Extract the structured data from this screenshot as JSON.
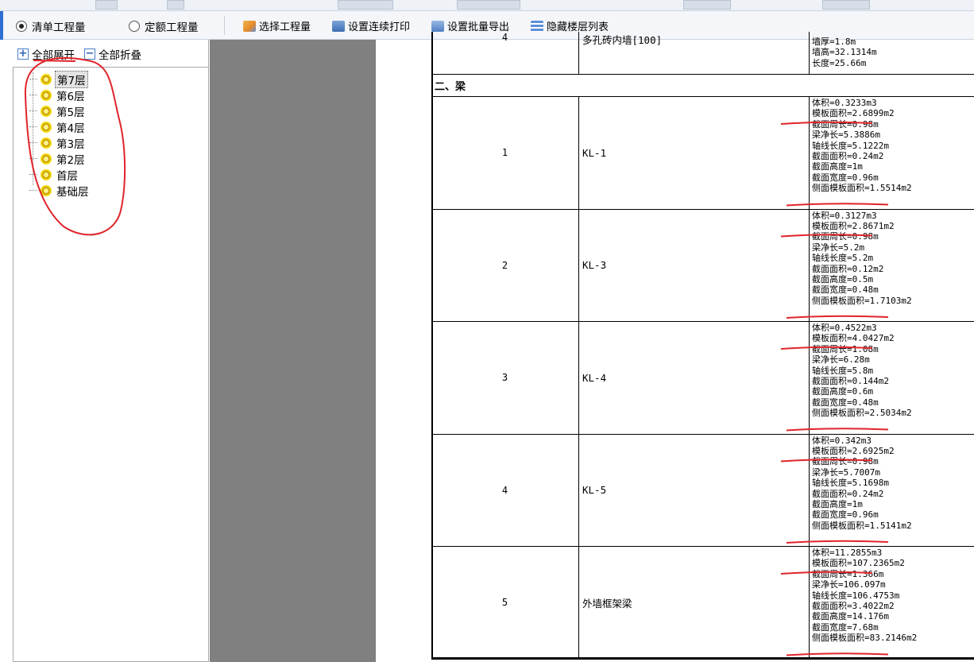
{
  "toolbar": {
    "radio_qingdan": "清单工程量",
    "radio_dinge": "定额工程量",
    "btn_select": "选择工程量",
    "btn_print": "设置连续打印",
    "btn_export": "设置批量导出",
    "btn_hide": "隐藏楼层列表"
  },
  "left_panel": {
    "expand_all": "全部展开",
    "collapse_all": "全部折叠",
    "floors": [
      "第7层",
      "第6层",
      "第5层",
      "第4层",
      "第3层",
      "第2层",
      "首层",
      "基础层"
    ],
    "selected_index": 0
  },
  "report": {
    "top_row": {
      "num": "4",
      "name": "多孔砖内墙[100]",
      "details": [
        "墙厚=1.8m",
        "墙高=32.1314m",
        "长度=25.66m"
      ]
    },
    "section_title": "二、梁",
    "rows": [
      {
        "num": "1",
        "name": "KL-1",
        "details": [
          "体积=0.3233m3",
          "模板面积=2.6899m2",
          "截面周长=0.98m",
          "梁净长=5.3886m",
          "轴线长度=5.1222m",
          "截面面积=0.24m2",
          "截面高度=1m",
          "截面宽度=0.96m",
          "侧面模板面积=1.5514m2"
        ]
      },
      {
        "num": "2",
        "name": "KL-3",
        "details": [
          "体积=0.3127m3",
          "模板面积=2.8671m2",
          "截面周长=0.98m",
          "梁净长=5.2m",
          "轴线长度=5.2m",
          "截面面积=0.12m2",
          "截面高度=0.5m",
          "截面宽度=0.48m",
          "侧面模板面积=1.7103m2"
        ]
      },
      {
        "num": "3",
        "name": "KL-4",
        "details": [
          "体积=0.4522m3",
          "模板面积=4.0427m2",
          "截面周长=1.08m",
          "梁净长=6.28m",
          "轴线长度=5.8m",
          "截面面积=0.144m2",
          "截面高度=0.6m",
          "截面宽度=0.48m",
          "侧面模板面积=2.5034m2"
        ]
      },
      {
        "num": "4",
        "name": "KL-5",
        "details": [
          "体积=0.342m3",
          "模板面积=2.6925m2",
          "截面周长=0.98m",
          "梁净长=5.7007m",
          "轴线长度=5.1698m",
          "截面面积=0.24m2",
          "截面高度=1m",
          "截面宽度=0.96m",
          "侧面模板面积=1.5141m2"
        ]
      },
      {
        "num": "5",
        "name": "外墙框架梁",
        "details": [
          "体积=11.2855m3",
          "模板面积=107.2365m2",
          "截面周长=1.366m",
          "梁净长=106.097m",
          "轴线长度=106.4753m",
          "截面面积=3.4022m2",
          "截面高度=14.176m",
          "截面宽度=7.68m",
          "侧面模板面积=83.2146m2"
        ]
      }
    ]
  },
  "colors": {
    "annotation_red": "#e0242a",
    "preview_gray": "#808080",
    "accent_blue": "#2f6fd1"
  }
}
